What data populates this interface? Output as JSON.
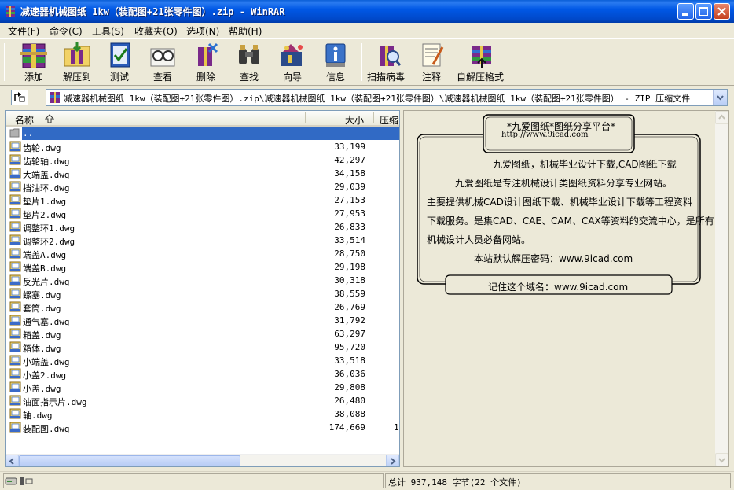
{
  "window": {
    "title": "减速器机械图纸 1kw（装配图+21张零件图）.zip - WinRAR"
  },
  "menu": [
    "文件(F)",
    "命令(C)",
    "工具(S)",
    "收藏夹(O)",
    "选项(N)",
    "帮助(H)"
  ],
  "toolbar": {
    "add": "添加",
    "extract": "解压到",
    "test": "测试",
    "view": "查看",
    "delete": "删除",
    "find": "查找",
    "wizard": "向导",
    "info": "信息",
    "scan": "扫描病毒",
    "comment": "注释",
    "sfx": "自解压格式"
  },
  "address": {
    "path": "减速器机械图纸 1kw（装配图+21张零件图）.zip\\减速器机械图纸 1kw（装配图+21张零件图）\\减速器机械图纸 1kw（装配图+21张零件图） - ZIP 压缩文件"
  },
  "columns": {
    "name": "名称",
    "size": "大小",
    "packed": "压缩"
  },
  "parent_row": "..",
  "files": [
    {
      "name": "齿轮.dwg",
      "size": "33,199"
    },
    {
      "name": "齿轮轴.dwg",
      "size": "42,297"
    },
    {
      "name": "大端盖.dwg",
      "size": "34,158"
    },
    {
      "name": "挡油环.dwg",
      "size": "29,039"
    },
    {
      "name": "垫片1.dwg",
      "size": "27,153"
    },
    {
      "name": "垫片2.dwg",
      "size": "27,953"
    },
    {
      "name": "调整环1.dwg",
      "size": "26,833"
    },
    {
      "name": "调整环2.dwg",
      "size": "33,514"
    },
    {
      "name": "端盖A.dwg",
      "size": "28,750"
    },
    {
      "name": "端盖B.dwg",
      "size": "29,198"
    },
    {
      "name": "反光片.dwg",
      "size": "30,318"
    },
    {
      "name": "螺塞.dwg",
      "size": "38,559"
    },
    {
      "name": "套筒.dwg",
      "size": "26,769"
    },
    {
      "name": "通气塞.dwg",
      "size": "31,792"
    },
    {
      "name": "箱盖.dwg",
      "size": "63,297"
    },
    {
      "name": "箱体.dwg",
      "size": "95,720"
    },
    {
      "name": "小端盖.dwg",
      "size": "33,518"
    },
    {
      "name": "小盖2.dwg",
      "size": "36,036"
    },
    {
      "name": "小盖.dwg",
      "size": "29,808"
    },
    {
      "name": "油面指示片.dwg",
      "size": "26,480"
    },
    {
      "name": "轴.dwg",
      "size": "38,088"
    },
    {
      "name": "装配图.dwg",
      "size": "174,669",
      "packed": "1"
    }
  ],
  "comment": {
    "header_title": "*九爱图纸*图纸分享平台*",
    "header_url": "http://www.9icad.com",
    "line1": "九爱图纸，机械毕业设计下载,CAD图纸下载",
    "line2": "九爱图纸是专注机械设计类图纸资料分享专业网站。",
    "line3": "主要提供机械CAD设计图纸下载、机械毕业设计下载等工程资料",
    "line4": "下载服务。是集CAD、CAE、CAM、CAX等资料的交流中心，是所有",
    "line5": "机械设计人员必备网站。",
    "line6": "本站默认解压密码：www.9icad.com",
    "footer": "记住这个域名：www.9icad.com"
  },
  "status": {
    "total": "总计 937,148 字节(22 个文件)"
  }
}
